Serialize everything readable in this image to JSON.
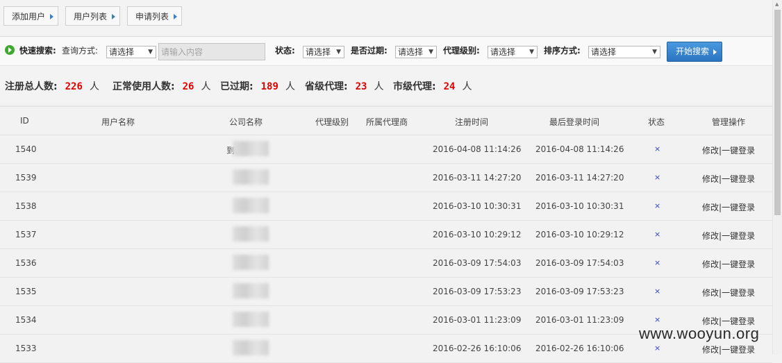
{
  "topbar": {
    "buttons": [
      "添加用户",
      "用户列表",
      "申请列表"
    ]
  },
  "search": {
    "quick_label": "快速搜索:",
    "query_mode_label": "查询方式:",
    "query_mode_value": "请选择",
    "input_placeholder": "请输入内容",
    "status_label": "状态:",
    "status_value": "请选择",
    "expired_label": "是否过期:",
    "expired_value": "请选择",
    "agent_level_label": "代理级别:",
    "agent_level_value": "请选择",
    "sort_label": "排序方式:",
    "sort_value": "请选择",
    "search_button": "开始搜索"
  },
  "stats": {
    "total_label": "注册总人数:",
    "total": "226",
    "active_label": "正常使用人数:",
    "active": "26",
    "expired_label": "已过期:",
    "expired": "189",
    "province_label": "省级代理:",
    "province": "23",
    "city_label": "市级代理:",
    "city": "24",
    "unit": "人"
  },
  "table": {
    "headers": [
      "ID",
      "用户名称",
      "公司名称",
      "代理级别",
      "所属代理商",
      "注册时间",
      "最后登录时间",
      "状态",
      "管理操作"
    ],
    "rows": [
      {
        "id": "1540",
        "company_hint": "到",
        "reg": "2016-04-08 11:14:26",
        "last": "2016-04-08 11:14:26",
        "status": "×"
      },
      {
        "id": "1539",
        "company_hint": "",
        "reg": "2016-03-11 14:27:20",
        "last": "2016-03-11 14:27:20",
        "status": "×"
      },
      {
        "id": "1538",
        "company_hint": "",
        "reg": "2016-03-10 10:30:31",
        "last": "2016-03-10 10:30:31",
        "status": "×"
      },
      {
        "id": "1537",
        "company_hint": "",
        "reg": "2016-03-10 10:29:12",
        "last": "2016-03-10 10:29:12",
        "status": "×"
      },
      {
        "id": "1536",
        "company_hint": "",
        "reg": "2016-03-09 17:54:03",
        "last": "2016-03-09 17:54:03",
        "status": "×"
      },
      {
        "id": "1535",
        "company_hint": "",
        "reg": "2016-03-09 17:53:23",
        "last": "2016-03-09 17:53:23",
        "status": "×"
      },
      {
        "id": "1534",
        "company_hint": "",
        "reg": "2016-03-01 11:23:09",
        "last": "2016-03-01 11:23:09",
        "status": "×"
      },
      {
        "id": "1533",
        "company_hint": "",
        "reg": "2016-02-26 16:10:06",
        "last": "2016-02-26 16:10:06",
        "status": "×"
      }
    ],
    "op_edit": "修改",
    "op_sep": "|",
    "op_login": "一键登录"
  },
  "watermark": "www.wooyun.org"
}
